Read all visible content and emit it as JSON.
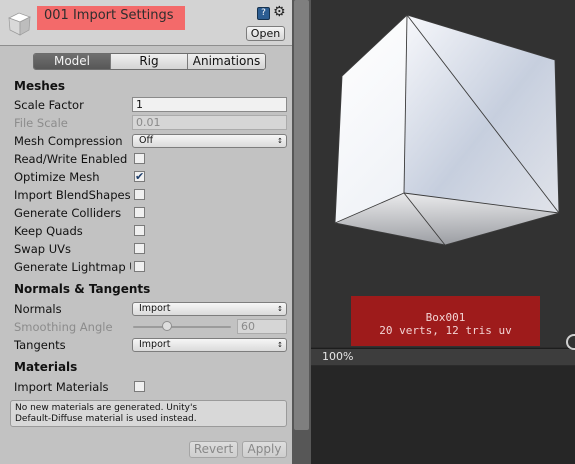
{
  "header": {
    "title": "001 Import Settings",
    "open_label": "Open",
    "help_glyph": "?",
    "gear_glyph": "⚙",
    "icons": [
      "asset-cube-icon",
      "help-icon",
      "gear-icon"
    ]
  },
  "tabs": [
    {
      "label": "Model",
      "active": true
    },
    {
      "label": "Rig",
      "active": false
    },
    {
      "label": "Animations",
      "active": false
    }
  ],
  "meshes": {
    "heading": "Meshes",
    "scale_factor": {
      "label": "Scale Factor",
      "value": "1"
    },
    "file_scale": {
      "label": "File Scale",
      "value": "0.01"
    },
    "mesh_compression": {
      "label": "Mesh Compression",
      "value": "Off"
    },
    "read_write": {
      "label": "Read/Write Enabled",
      "checked": false
    },
    "optimize_mesh": {
      "label": "Optimize Mesh",
      "checked": true
    },
    "import_blendshapes": {
      "label": "Import BlendShapes",
      "checked": false
    },
    "generate_colliders": {
      "label": "Generate Colliders",
      "checked": false
    },
    "keep_quads": {
      "label": "Keep Quads",
      "checked": false
    },
    "swap_uvs": {
      "label": "Swap UVs",
      "checked": false
    },
    "generate_lightmap": {
      "label": "Generate Lightmap UVs",
      "checked": false
    }
  },
  "normals_tangents": {
    "heading": "Normals & Tangents",
    "normals": {
      "label": "Normals",
      "value": "Import"
    },
    "smoothing_angle": {
      "label": "Smoothing Angle",
      "value": "60",
      "slider_fraction": 0.33
    },
    "tangents": {
      "label": "Tangents",
      "value": "Import"
    }
  },
  "materials": {
    "heading": "Materials",
    "import_materials": {
      "label": "Import Materials",
      "checked": false
    },
    "note_line1": "No new materials are generated. Unity's",
    "note_line2": "Default-Diffuse material is used instead."
  },
  "footer": {
    "revert_label": "Revert",
    "apply_label": "Apply"
  },
  "preview": {
    "mesh_name": "Box001",
    "stats": "20 verts, 12 tris   uv",
    "zoom": "100%"
  },
  "colors": {
    "title_highlight": "#f36a6a",
    "info_box": "#9e1b1b",
    "active_tab": "#606060"
  }
}
